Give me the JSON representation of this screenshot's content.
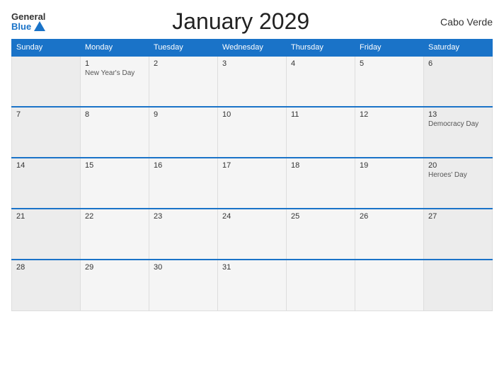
{
  "logo": {
    "general": "General",
    "blue": "Blue"
  },
  "header": {
    "title": "January 2029",
    "country": "Cabo Verde"
  },
  "weekdays": [
    "Sunday",
    "Monday",
    "Tuesday",
    "Wednesday",
    "Thursday",
    "Friday",
    "Saturday"
  ],
  "weeks": [
    [
      {
        "day": "",
        "event": ""
      },
      {
        "day": "1",
        "event": "New Year's Day"
      },
      {
        "day": "2",
        "event": ""
      },
      {
        "day": "3",
        "event": ""
      },
      {
        "day": "4",
        "event": ""
      },
      {
        "day": "5",
        "event": ""
      },
      {
        "day": "6",
        "event": ""
      }
    ],
    [
      {
        "day": "7",
        "event": ""
      },
      {
        "day": "8",
        "event": ""
      },
      {
        "day": "9",
        "event": ""
      },
      {
        "day": "10",
        "event": ""
      },
      {
        "day": "11",
        "event": ""
      },
      {
        "day": "12",
        "event": ""
      },
      {
        "day": "13",
        "event": "Democracy Day"
      }
    ],
    [
      {
        "day": "14",
        "event": ""
      },
      {
        "day": "15",
        "event": ""
      },
      {
        "day": "16",
        "event": ""
      },
      {
        "day": "17",
        "event": ""
      },
      {
        "day": "18",
        "event": ""
      },
      {
        "day": "19",
        "event": ""
      },
      {
        "day": "20",
        "event": "Heroes' Day"
      }
    ],
    [
      {
        "day": "21",
        "event": ""
      },
      {
        "day": "22",
        "event": ""
      },
      {
        "day": "23",
        "event": ""
      },
      {
        "day": "24",
        "event": ""
      },
      {
        "day": "25",
        "event": ""
      },
      {
        "day": "26",
        "event": ""
      },
      {
        "day": "27",
        "event": ""
      }
    ],
    [
      {
        "day": "28",
        "event": ""
      },
      {
        "day": "29",
        "event": ""
      },
      {
        "day": "30",
        "event": ""
      },
      {
        "day": "31",
        "event": ""
      },
      {
        "day": "",
        "event": ""
      },
      {
        "day": "",
        "event": ""
      },
      {
        "day": "",
        "event": ""
      }
    ]
  ]
}
